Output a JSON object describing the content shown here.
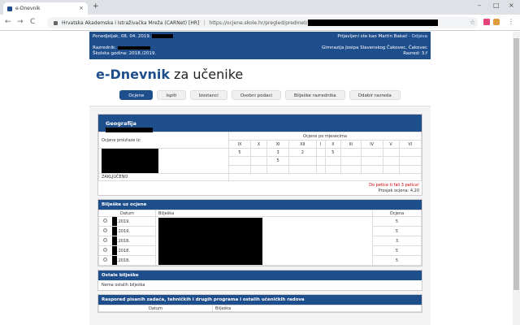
{
  "browser": {
    "tab_title": "e-Dnevnik",
    "tab_close": "×",
    "new_tab": "+",
    "win_min": "–",
    "win_max": "□",
    "win_close": "×",
    "back": "←",
    "forward": "→",
    "reload": "C",
    "org": "Hrvatska Akademska i Istraživačka Mreža (CARNet) [HR]",
    "separator": "|",
    "url": "https://ocjene.skole.hr/pregled/predmet/",
    "star": "☆",
    "menu": "⋮"
  },
  "topbar": {
    "date": "Ponedjeljak, 08. 04. 2019.",
    "user": "Prijavljeni ste kao Martin Bakač",
    "logout": "Odjava",
    "razred_label": "Razrednik:",
    "godina": "Školska godina: 2018./2019.",
    "skola": "Gimnazija Josipa Slavenskog Čakovec, Čakovec",
    "razred": "Razred: 3.f"
  },
  "brand": {
    "bold": "e-Dnevnik",
    "rest": " za učenike"
  },
  "tabs": [
    "Ocjene",
    "Ispiti",
    "Izostanci",
    "Osobni podaci",
    "Bilješke razrednika",
    "Odabir razreda"
  ],
  "subject": {
    "name": "Geografija",
    "grades_title": "Ocjene po mjesecima",
    "row_label": "Ocjene proizlaze iz:",
    "months": [
      "IX",
      "X",
      "XI",
      "XII",
      "I",
      "II",
      "III",
      "IV",
      "V",
      "VI"
    ],
    "rows": [
      [
        "5",
        "",
        "3",
        "2",
        "",
        "5",
        "",
        "",
        "",
        ""
      ],
      [
        "",
        "",
        "5",
        "",
        "",
        "",
        "",
        "",
        "",
        ""
      ],
      [
        "",
        "",
        "",
        "",
        "",
        "",
        "",
        "",
        "",
        ""
      ]
    ],
    "final_label": "ZAKLJUČENO",
    "remark": "Do petice ti fali 3 petica!",
    "average": "Prosjek ocjena: 4,20"
  },
  "notes": {
    "title": "Bilješke uz ocjene",
    "col_date": "Datum",
    "col_note": "Bilješka",
    "col_grade": "Ocjena",
    "rows": [
      {
        "date": ".2019.",
        "grade": "5"
      },
      {
        "date": ".2019.",
        "grade": "5"
      },
      {
        "date": ".2018.",
        "grade": "3"
      },
      {
        "date": ".2018.",
        "grade": "5"
      },
      {
        "date": ".2018.",
        "grade": "5"
      }
    ]
  },
  "other": {
    "title": "Ostale bilješke",
    "empty": "Nema ostalih bilješka"
  },
  "schedule": {
    "title": "Raspored pisanih zadaća, tehničkih i drugih programa i ostalih učeničkih radova",
    "col_date": "Datum",
    "col_note": "Bilješka"
  }
}
